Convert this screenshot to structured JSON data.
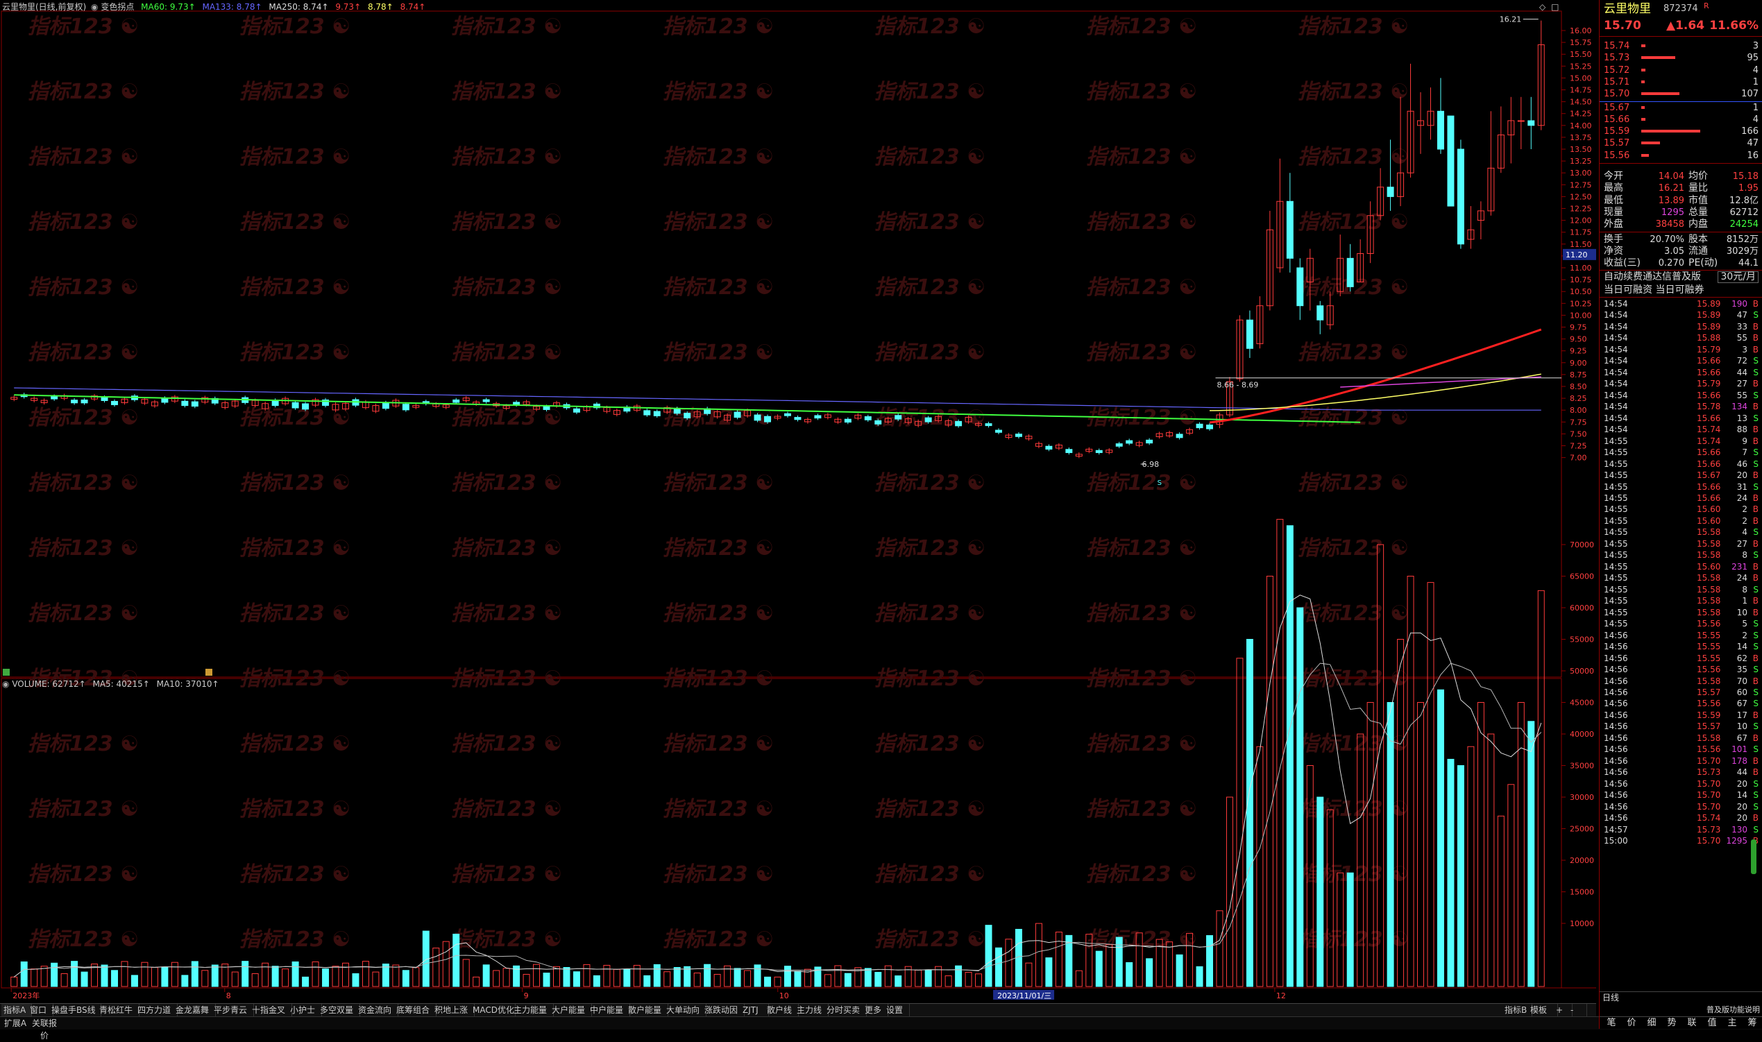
{
  "header": {
    "stock_title": "云里物里(日线,前复权)",
    "indicator_name": "变色拐点",
    "ma60_label": "MA60: 9.73↑",
    "ma133_label": "MA133: 8.78↑",
    "ma250_label": "MA250: 8.74↑",
    "extra1": "9.73↑",
    "extra2": "8.78↑",
    "extra3": "8.74↑"
  },
  "volume_header": {
    "volume_label": "VOLUME: 62712↑",
    "ma5_label": "MA5: 40215↑",
    "ma10_label": "MA10: 37010↑"
  },
  "annotations": {
    "high_label": "16.21",
    "low_label": "6.98",
    "range_label": "8.66 - 8.69",
    "current_price_tag": "11.20",
    "marker_s": "S"
  },
  "price_axis": [
    "16.00",
    "15.75",
    "15.50",
    "15.25",
    "15.00",
    "14.75",
    "14.50",
    "14.25",
    "14.00",
    "13.75",
    "13.50",
    "13.25",
    "13.00",
    "12.75",
    "12.50",
    "12.25",
    "12.00",
    "11.75",
    "11.50",
    "11.25",
    "11.00",
    "10.75",
    "10.50",
    "10.25",
    "10.00",
    "9.75",
    "9.50",
    "9.25",
    "9.00",
    "8.75",
    "8.50",
    "8.25",
    "8.00",
    "7.75",
    "7.50",
    "7.25",
    "7.00"
  ],
  "volume_axis": [
    "70000",
    "65000",
    "60000",
    "55000",
    "50000",
    "45000",
    "40000",
    "35000",
    "30000",
    "25000",
    "20000",
    "15000",
    "10000"
  ],
  "date_axis": [
    {
      "label": "2023年",
      "pos": 0.005
    },
    {
      "label": "8",
      "pos": 0.142
    },
    {
      "label": "9",
      "pos": 0.333
    },
    {
      "label": "10",
      "pos": 0.497
    },
    {
      "label": "2023/11/01/三",
      "pos": 0.637
    },
    {
      "label": "12",
      "pos": 0.816
    }
  ],
  "watermark": "指标123",
  "bottom_tabs": [
    "指标A",
    "窗口",
    "操盘手BS线",
    "青松红牛",
    "四方力道",
    "金龙嘉舞",
    "平步青云",
    "十指金叉",
    "小护士",
    "多空双量",
    "资金流向",
    "底筹组合",
    "积地上涨",
    "MACD优化",
    "主力能量",
    "大户能量",
    "中户能量",
    "散户能量",
    "大单动向",
    "涨跌动因",
    "ZJTJ",
    "散户线",
    "主力线",
    "分时买卖",
    "更多",
    "设置"
  ],
  "bottom_right_tabs": [
    "指标B",
    "模板",
    "+",
    "-"
  ],
  "footer_tabs": [
    "扩展A",
    "关联报价"
  ],
  "panel": {
    "stock_name": "云里物里",
    "stock_code": "872374",
    "r_badge": "R",
    "price": "15.70",
    "change": "▲1.64",
    "change_pct": "11.66%",
    "asks": [
      {
        "price": "15.74",
        "vol": "3",
        "bar": 0.02
      },
      {
        "price": "15.73",
        "vol": "95",
        "bar": 0.5
      },
      {
        "price": "15.72",
        "vol": "4",
        "bar": 0.02
      },
      {
        "price": "15.71",
        "vol": "1",
        "bar": 0.01
      },
      {
        "price": "15.70",
        "vol": "107",
        "bar": 0.57
      }
    ],
    "bids": [
      {
        "price": "15.67",
        "vol": "1",
        "bar": 0.01
      },
      {
        "price": "15.66",
        "vol": "4",
        "bar": 0.02
      },
      {
        "price": "15.59",
        "vol": "166",
        "bar": 0.9
      },
      {
        "price": "15.57",
        "vol": "47",
        "bar": 0.25
      },
      {
        "price": "15.56",
        "vol": "16",
        "bar": 0.08
      }
    ],
    "stats": [
      {
        "l1": "今开",
        "v1": "14.04",
        "c1": "#ff4040",
        "l2": "均价",
        "v2": "15.18",
        "c2": "#ff4040"
      },
      {
        "l1": "最高",
        "v1": "16.21",
        "c1": "#ff4040",
        "l2": "量比",
        "v2": "1.95",
        "c2": "#ff4040"
      },
      {
        "l1": "最低",
        "v1": "13.89",
        "c1": "#ff4040",
        "l2": "市值",
        "v2": "12.8亿",
        "c2": "#dddddd"
      },
      {
        "l1": "现量",
        "v1": "1295",
        "c1": "#dd44dd",
        "l2": "总量",
        "v2": "62712",
        "c2": "#dddddd"
      },
      {
        "l1": "外盘",
        "v1": "38458",
        "c1": "#ff4040",
        "l2": "内盘",
        "v2": "24254",
        "c2": "#40ff40"
      }
    ],
    "stats2": [
      {
        "l1": "换手",
        "v1": "20.70%",
        "l2": "股本",
        "v2": "8152万"
      },
      {
        "l1": "净资",
        "v1": "3.05",
        "l2": "流通",
        "v2": "3029万"
      },
      {
        "l1": "收益(三)",
        "v1": "0.270",
        "l2": "PE(动)",
        "v2": "44.1"
      }
    ],
    "promo": "自动续费通达信普及版",
    "promo_price": "30元/月",
    "promo2": "当日可融资 当日可融券",
    "trades": [
      [
        "14:54",
        "15.89",
        "190",
        "B"
      ],
      [
        "14:54",
        "15.89",
        "47",
        "S"
      ],
      [
        "14:54",
        "15.89",
        "33",
        "B"
      ],
      [
        "14:54",
        "15.88",
        "55",
        "B"
      ],
      [
        "14:54",
        "15.79",
        "3",
        "B"
      ],
      [
        "14:54",
        "15.66",
        "72",
        "S"
      ],
      [
        "14:54",
        "15.66",
        "44",
        "S"
      ],
      [
        "14:54",
        "15.79",
        "27",
        "B"
      ],
      [
        "14:54",
        "15.66",
        "55",
        "S"
      ],
      [
        "14:54",
        "15.78",
        "134",
        "B"
      ],
      [
        "14:54",
        "15.66",
        "13",
        "S"
      ],
      [
        "14:54",
        "15.74",
        "88",
        "B"
      ],
      [
        "14:55",
        "15.74",
        "9",
        "B"
      ],
      [
        "14:55",
        "15.66",
        "7",
        "S"
      ],
      [
        "14:55",
        "15.66",
        "46",
        "S"
      ],
      [
        "14:55",
        "15.67",
        "20",
        "B"
      ],
      [
        "14:55",
        "15.66",
        "31",
        "S"
      ],
      [
        "14:55",
        "15.66",
        "24",
        "B"
      ],
      [
        "14:55",
        "15.60",
        "2",
        "B"
      ],
      [
        "14:55",
        "15.60",
        "2",
        "B"
      ],
      [
        "14:55",
        "15.58",
        "4",
        "S"
      ],
      [
        "14:55",
        "15.58",
        "27",
        "B"
      ],
      [
        "14:55",
        "15.58",
        "8",
        "S"
      ],
      [
        "14:55",
        "15.60",
        "231",
        "B"
      ],
      [
        "14:55",
        "15.58",
        "24",
        "B"
      ],
      [
        "14:55",
        "15.58",
        "8",
        "S"
      ],
      [
        "14:55",
        "15.58",
        "1",
        "B"
      ],
      [
        "14:55",
        "15.58",
        "10",
        "B"
      ],
      [
        "14:55",
        "15.56",
        "5",
        "S"
      ],
      [
        "14:56",
        "15.55",
        "2",
        "S"
      ],
      [
        "14:56",
        "15.55",
        "14",
        "S"
      ],
      [
        "14:56",
        "15.55",
        "62",
        "B"
      ],
      [
        "14:56",
        "15.56",
        "35",
        "S"
      ],
      [
        "14:56",
        "15.58",
        "70",
        "B"
      ],
      [
        "14:56",
        "15.57",
        "60",
        "S"
      ],
      [
        "14:56",
        "15.56",
        "67",
        "S"
      ],
      [
        "14:56",
        "15.59",
        "17",
        "B"
      ],
      [
        "14:56",
        "15.57",
        "10",
        "S"
      ],
      [
        "14:56",
        "15.58",
        "67",
        "B"
      ],
      [
        "14:56",
        "15.56",
        "101",
        "S"
      ],
      [
        "14:56",
        "15.70",
        "178",
        "B"
      ],
      [
        "14:56",
        "15.73",
        "44",
        "B"
      ],
      [
        "14:56",
        "15.70",
        "20",
        "S"
      ],
      [
        "14:56",
        "15.70",
        "14",
        "S"
      ],
      [
        "14:56",
        "15.70",
        "20",
        "S"
      ],
      [
        "14:56",
        "15.74",
        "20",
        "B"
      ],
      [
        "14:57",
        "15.73",
        "130",
        "S"
      ],
      [
        "15:00",
        "15.70",
        "1295",
        "B"
      ]
    ],
    "right_bottom_tab": "日线",
    "right_footer_link": "普及版功能说明",
    "right_footer_tabs": [
      "笔",
      "价",
      "细",
      "势",
      "联",
      "值",
      "主",
      "筹"
    ]
  }
}
